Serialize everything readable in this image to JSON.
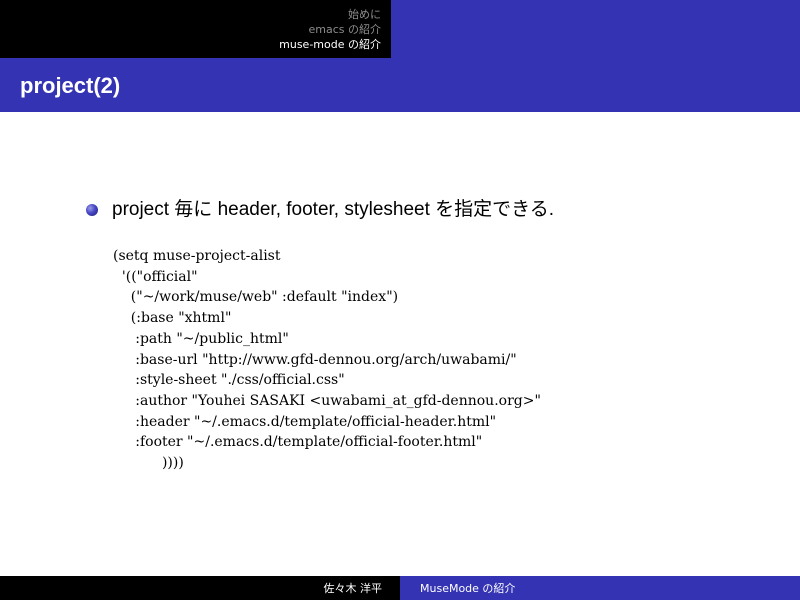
{
  "header": {
    "sections": [
      {
        "label": "始めに",
        "current": false
      },
      {
        "label": "emacs の紹介",
        "current": false
      },
      {
        "label": "muse-mode の紹介",
        "current": true
      }
    ]
  },
  "frame": {
    "title": "project(2)"
  },
  "content": {
    "bullet": "project 毎に header, footer, stylesheet を指定できる.",
    "code": "(setq muse-project-alist\n  '((\"official\"\n    (\"~/work/muse/web\" :default \"index\")\n    (:base \"xhtml\"\n     :path \"~/public_html\"\n     :base-url \"http://www.gfd-dennou.org/arch/uwabami/\"\n     :style-sheet \"./css/official.css\"\n     :author \"Youhei SASAKI <uwabami_at_gfd-dennou.org>\"\n     :header \"~/.emacs.d/template/official-header.html\"\n     :footer \"~/.emacs.d/template/official-footer.html\"\n           ))))"
  },
  "footer": {
    "author": "佐々木 洋平",
    "title": "MuseMode の紹介"
  },
  "colors": {
    "header_left": "#000000",
    "accent": "#3333b3",
    "inactive_nav": "#8c8c8c"
  }
}
